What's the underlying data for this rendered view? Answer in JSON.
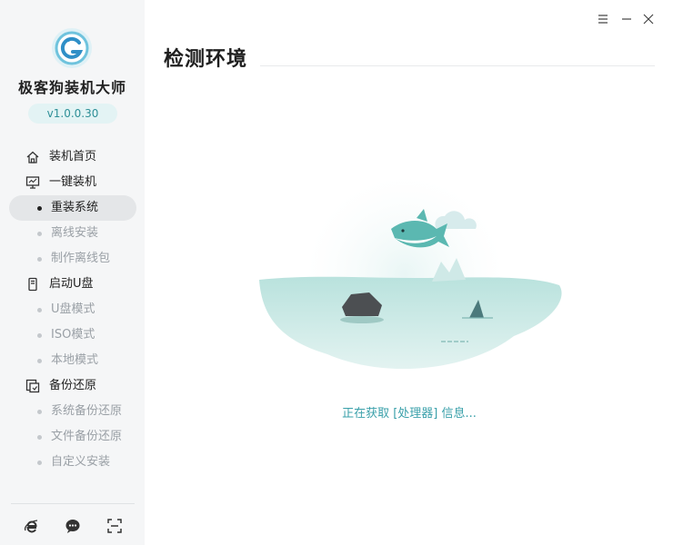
{
  "app": {
    "name": "极客狗装机大师",
    "version": "v1.0.0.30",
    "accent": "#3aa0aa"
  },
  "sidebar": {
    "items": [
      {
        "type": "section",
        "label": "装机首页",
        "icon": "home-icon"
      },
      {
        "type": "section",
        "label": "一键装机",
        "icon": "monitor-icon"
      },
      {
        "type": "sub",
        "label": "重装系统",
        "active": true
      },
      {
        "type": "sub",
        "label": "离线安装"
      },
      {
        "type": "sub",
        "label": "制作离线包"
      },
      {
        "type": "section",
        "label": "启动U盘",
        "icon": "usb-icon"
      },
      {
        "type": "sub",
        "label": "U盘模式"
      },
      {
        "type": "sub",
        "label": "ISO模式"
      },
      {
        "type": "sub",
        "label": "本地模式"
      },
      {
        "type": "section",
        "label": "备份还原",
        "icon": "backup-icon"
      },
      {
        "type": "sub",
        "label": "系统备份还原"
      },
      {
        "type": "sub",
        "label": "文件备份还原"
      },
      {
        "type": "sub",
        "label": "自定义安装"
      }
    ],
    "bottom_tools": [
      "browser-icon",
      "chat-icon",
      "screenshot-icon"
    ]
  },
  "main": {
    "title": "检测环境",
    "status_text": "正在获取 [处理器] 信息..."
  },
  "window_controls": [
    "menu-icon",
    "minimize-icon",
    "close-icon"
  ]
}
